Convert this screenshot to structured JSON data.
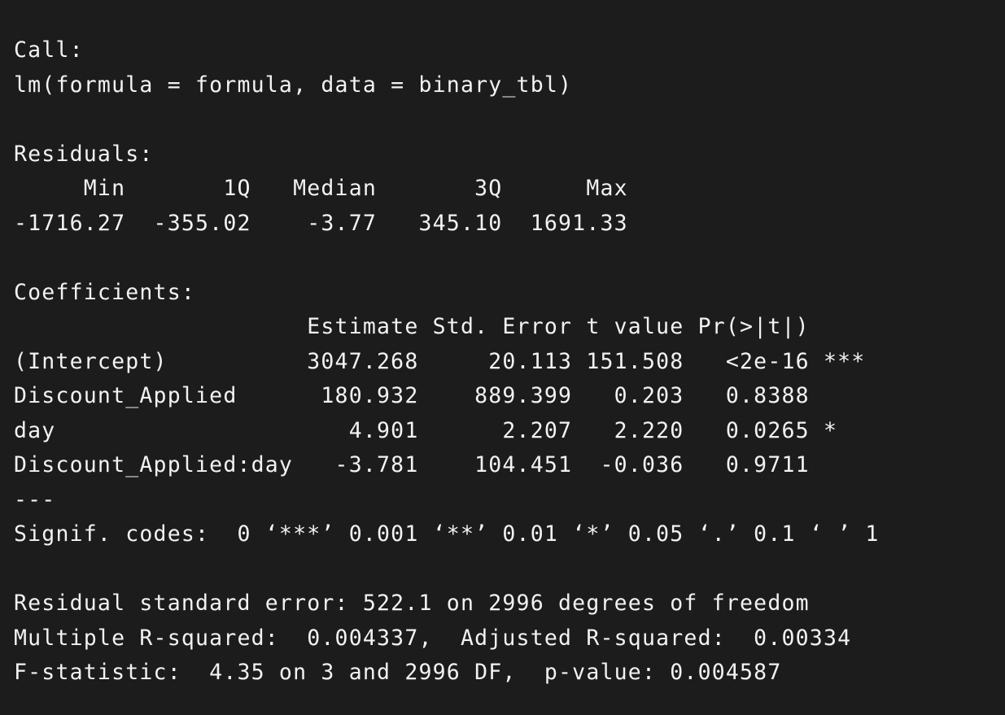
{
  "output": {
    "call_header": "Call:",
    "call": "lm(formula = formula, data = binary_tbl)",
    "residuals_header": "Residuals:",
    "residuals_cols": "     Min       1Q   Median       3Q      Max ",
    "residuals_vals": "-1716.27  -355.02    -3.77   345.10  1691.33 ",
    "coefficients_header": "Coefficients:",
    "coef_cols": "                     Estimate Std. Error t value Pr(>|t|)    ",
    "coef_rows": [
      "(Intercept)          3047.268     20.113 151.508   <2e-16 ***",
      "Discount_Applied      180.932    889.399   0.203   0.8388    ",
      "day                     4.901      2.207   2.220   0.0265 *  ",
      "Discount_Applied:day   -3.781    104.451  -0.036   0.9711    "
    ],
    "separator": "---",
    "signif_codes": "Signif. codes:  0 ‘***’ 0.001 ‘**’ 0.01 ‘*’ 0.05 ‘.’ 0.1 ‘ ’ 1",
    "residual_se": "Residual standard error: 522.1 on 2996 degrees of freedom",
    "r_squared": "Multiple R-squared:  0.004337,\tAdjusted R-squared:  0.00334 ",
    "f_statistic": "F-statistic:  4.35 on 3 and 2996 DF,  p-value: 0.004587"
  }
}
